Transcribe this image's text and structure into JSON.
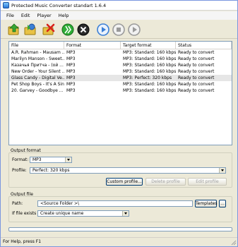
{
  "window": {
    "title": "Protected Music Converter standart 1.6.4"
  },
  "menu": [
    "File",
    "Edit",
    "Player",
    "Help"
  ],
  "toolbar": {
    "buttons": [
      {
        "name": "add-files-icon"
      },
      {
        "name": "add-folder-icon"
      },
      {
        "name": "remove-icon"
      },
      {
        "name": "convert-icon"
      },
      {
        "name": "stop-conversion-icon"
      },
      {
        "name": "play-icon"
      },
      {
        "name": "stop-icon"
      },
      {
        "name": "pause-icon"
      }
    ]
  },
  "list": {
    "columns": [
      "File",
      "Format",
      "Target format",
      "Status"
    ],
    "rows": [
      {
        "file": "A.R. Rahman - Mausam ...",
        "format": "MP3",
        "target": "MP3: Standard: 160 kbps",
        "status": "Ready to convert"
      },
      {
        "file": "Marilyn Manson - Sweet...",
        "format": "MP3",
        "target": "MP3: Standard: 160 kbps",
        "status": "Ready to convert"
      },
      {
        "file": "Казачья Притча - (ой ...",
        "format": "MP3",
        "target": "MP3: Standard: 160 kbps",
        "status": "Ready to convert"
      },
      {
        "file": "New Order - Your Silent ...",
        "format": "MP3",
        "target": "MP3: Standard: 160 kbps",
        "status": "Ready to convert"
      },
      {
        "file": "Glass Candy - Digital Ve...",
        "format": "MP3",
        "target": "MP3: Perfect: 320 kbps",
        "status": "Ready to convert",
        "selected": true
      },
      {
        "file": "Pet Shop Boys - It's A Sin",
        "format": "MP3",
        "target": "MP3: Standard: 160 kbps",
        "status": "Ready to convert"
      },
      {
        "file": "20. Garvey - Goodbye ...",
        "format": "MP3",
        "target": "MP3: Standard: 160 kbps",
        "status": "Ready to convert"
      }
    ]
  },
  "output_format": {
    "group_label": "Output format",
    "format_label": "Format:",
    "format_value": "MP3",
    "profile_label": "Profile:",
    "profile_value": "Perfect: 320 kbps",
    "custom_profile_button": "Custom profile...",
    "delete_profile_button": "Delete profile",
    "edit_profile_button": "Edit profile"
  },
  "output_file": {
    "group_label": "Output file",
    "path_label": "Path:",
    "path_value": "<Source Folder >\\",
    "templates_button": "Templates",
    "browse_button": "...",
    "exists_label": "If file exists",
    "exists_value": "Create unique name"
  },
  "progress": {
    "fraction": 0
  },
  "status": {
    "text": "For Help, press F1"
  }
}
